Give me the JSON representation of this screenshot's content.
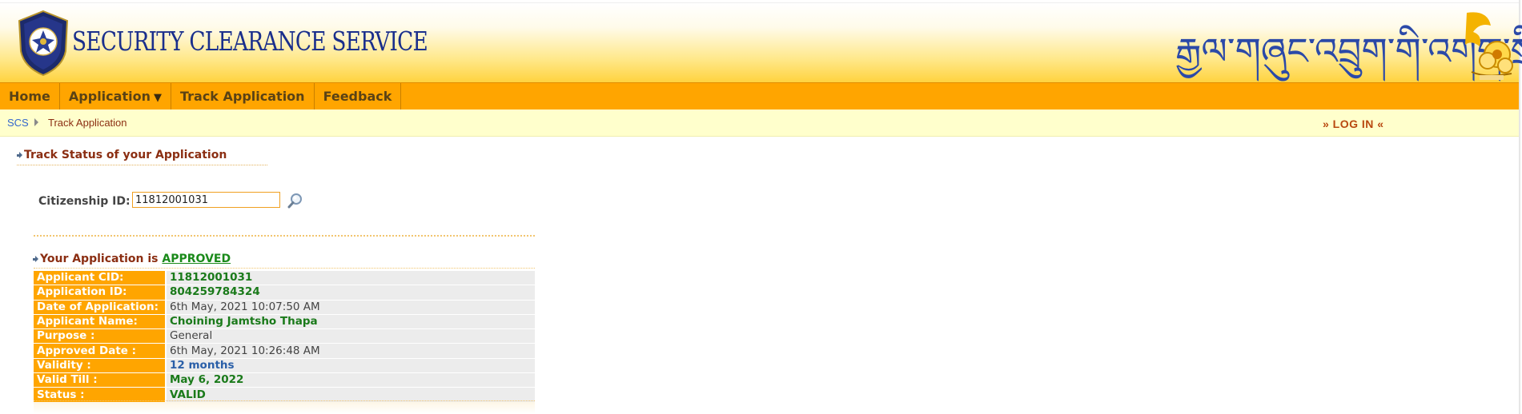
{
  "header": {
    "site_title": "SECURITY CLEARANCE SERVICE",
    "dzongkha_title": "རྒྱལ་གཞུང་འབྲུག་གི་འགག་སྲི།",
    "logo_icon": "royal-bhutan-police-badge-icon",
    "emblem_icon": "dragon-emblem-icon"
  },
  "nav": {
    "items": [
      "Home",
      "Application",
      "Track Application",
      "Feedback"
    ],
    "application_caret": "▼"
  },
  "breadcrumb": {
    "home": "SCS",
    "current": "Track Application"
  },
  "login": "» LOG IN «",
  "section": {
    "heading": "Track Status of your Application"
  },
  "search": {
    "label": "Citizenship ID:",
    "value": "11812001031",
    "icon": "magnifier-search-icon"
  },
  "result": {
    "prefix": "Your Application is",
    "status": "APPROVED",
    "rows": [
      {
        "label": "Applicant CID:",
        "value": "11812001031"
      },
      {
        "label": "Application ID:",
        "value": "804259784324"
      },
      {
        "label": "Date of Application:",
        "value": "6th May, 2021 10:07:50 AM"
      },
      {
        "label": "Applicant Name:",
        "value": "Choining Jamtsho Thapa"
      },
      {
        "label": "Purpose :",
        "value": "General"
      },
      {
        "label": "Approved Date :",
        "value": "6th May, 2021 10:26:48 AM"
      },
      {
        "label": "Validity :",
        "value": "12 months"
      },
      {
        "label": "Valid Till :",
        "value": "May 6, 2022"
      },
      {
        "label": "Status :",
        "value": "VALID"
      }
    ]
  },
  "colors": {
    "nav_orange": "#ffa500",
    "crumb_yellow": "#ffffcc",
    "heading_brown": "#8b2e12",
    "value_green": "#1a7a1a",
    "title_blue": "#1a2f8c"
  }
}
